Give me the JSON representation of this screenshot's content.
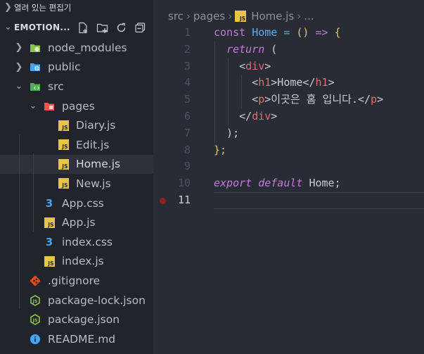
{
  "sidebar": {
    "open_editors_label": "열려 있는 편집기",
    "root_title": "EMOTION...",
    "root_actions": [
      "new-file-icon",
      "new-folder-icon",
      "refresh-icon",
      "collapse-all-icon"
    ],
    "items": [
      {
        "label": "node_modules",
        "icon": "node-folder-icon",
        "kind": "folder",
        "expanded": false,
        "depth": 0
      },
      {
        "label": "public",
        "icon": "public-folder-icon",
        "kind": "folder",
        "expanded": false,
        "depth": 0
      },
      {
        "label": "src",
        "icon": "src-folder-icon",
        "kind": "folder",
        "expanded": true,
        "depth": 0
      },
      {
        "label": "pages",
        "icon": "pages-folder-icon",
        "kind": "folder",
        "expanded": true,
        "depth": 1
      },
      {
        "label": "Diary.js",
        "icon": "js-file-icon",
        "kind": "file",
        "depth": 2
      },
      {
        "label": "Edit.js",
        "icon": "js-file-icon",
        "kind": "file",
        "depth": 2
      },
      {
        "label": "Home.js",
        "icon": "js-file-icon",
        "kind": "file",
        "depth": 2,
        "selected": true
      },
      {
        "label": "New.js",
        "icon": "js-file-icon",
        "kind": "file",
        "depth": 2
      },
      {
        "label": "App.css",
        "icon": "css-file-icon",
        "kind": "file",
        "depth": 1
      },
      {
        "label": "App.js",
        "icon": "js-file-icon",
        "kind": "file",
        "depth": 1
      },
      {
        "label": "index.css",
        "icon": "css-file-icon",
        "kind": "file",
        "depth": 1
      },
      {
        "label": "index.js",
        "icon": "js-file-icon",
        "kind": "file",
        "depth": 1
      },
      {
        "label": ".gitignore",
        "icon": "git-file-icon",
        "kind": "file",
        "depth": 0
      },
      {
        "label": "package-lock.json",
        "icon": "nodejs-file-icon",
        "kind": "file",
        "depth": 0
      },
      {
        "label": "package.json",
        "icon": "nodejs-file-icon",
        "kind": "file",
        "depth": 0
      },
      {
        "label": "README.md",
        "icon": "info-file-icon",
        "kind": "file",
        "depth": 0
      }
    ]
  },
  "breadcrumb": {
    "parts": [
      "src",
      "pages",
      "Home.js",
      "..."
    ],
    "file_icon_label": "JS"
  },
  "editor": {
    "active_line": 11,
    "breakpoint_line": 11,
    "lines": [
      {
        "num": "1",
        "tokens": [
          {
            "t": "const ",
            "c": "kw"
          },
          {
            "t": "Home",
            "c": "fn"
          },
          {
            "t": " = ",
            "c": "op"
          },
          {
            "t": "()",
            "c": "pl"
          },
          {
            "t": " => ",
            "c": "kw"
          },
          {
            "t": "{",
            "c": "pl"
          }
        ]
      },
      {
        "num": "2",
        "tokens": [
          {
            "t": "  "
          },
          {
            "t": "return",
            "c": "it"
          },
          {
            "t": " ("
          }
        ]
      },
      {
        "num": "3",
        "tokens": [
          {
            "t": "    <"
          },
          {
            "t": "div",
            "c": "tag"
          },
          {
            "t": ">"
          }
        ]
      },
      {
        "num": "4",
        "tokens": [
          {
            "t": "      <"
          },
          {
            "t": "h1",
            "c": "tag"
          },
          {
            "t": ">Home</"
          },
          {
            "t": "h1",
            "c": "tag"
          },
          {
            "t": ">"
          }
        ]
      },
      {
        "num": "5",
        "tokens": [
          {
            "t": "      <"
          },
          {
            "t": "p",
            "c": "tag"
          },
          {
            "t": ">이곳은 홈 입니다.</"
          },
          {
            "t": "p",
            "c": "tag"
          },
          {
            "t": ">"
          }
        ]
      },
      {
        "num": "6",
        "tokens": [
          {
            "t": "    </"
          },
          {
            "t": "div",
            "c": "tag"
          },
          {
            "t": ">"
          }
        ]
      },
      {
        "num": "7",
        "tokens": [
          {
            "t": "  );"
          }
        ]
      },
      {
        "num": "8",
        "tokens": [
          {
            "t": "};",
            "c": "pl"
          }
        ]
      },
      {
        "num": "9",
        "tokens": []
      },
      {
        "num": "10",
        "tokens": [
          {
            "t": "export",
            "c": "it"
          },
          {
            "t": " "
          },
          {
            "t": "default",
            "c": "it"
          },
          {
            "t": " Home;"
          }
        ]
      },
      {
        "num": "11",
        "tokens": []
      }
    ]
  },
  "colors": {
    "sidebar_bg": "#21252b",
    "editor_bg": "#282c34",
    "keyword": "#c678dd",
    "function": "#61afef",
    "tag": "#e06c75",
    "js_badge": "#e8c548",
    "css_icon": "#42a5f5"
  }
}
